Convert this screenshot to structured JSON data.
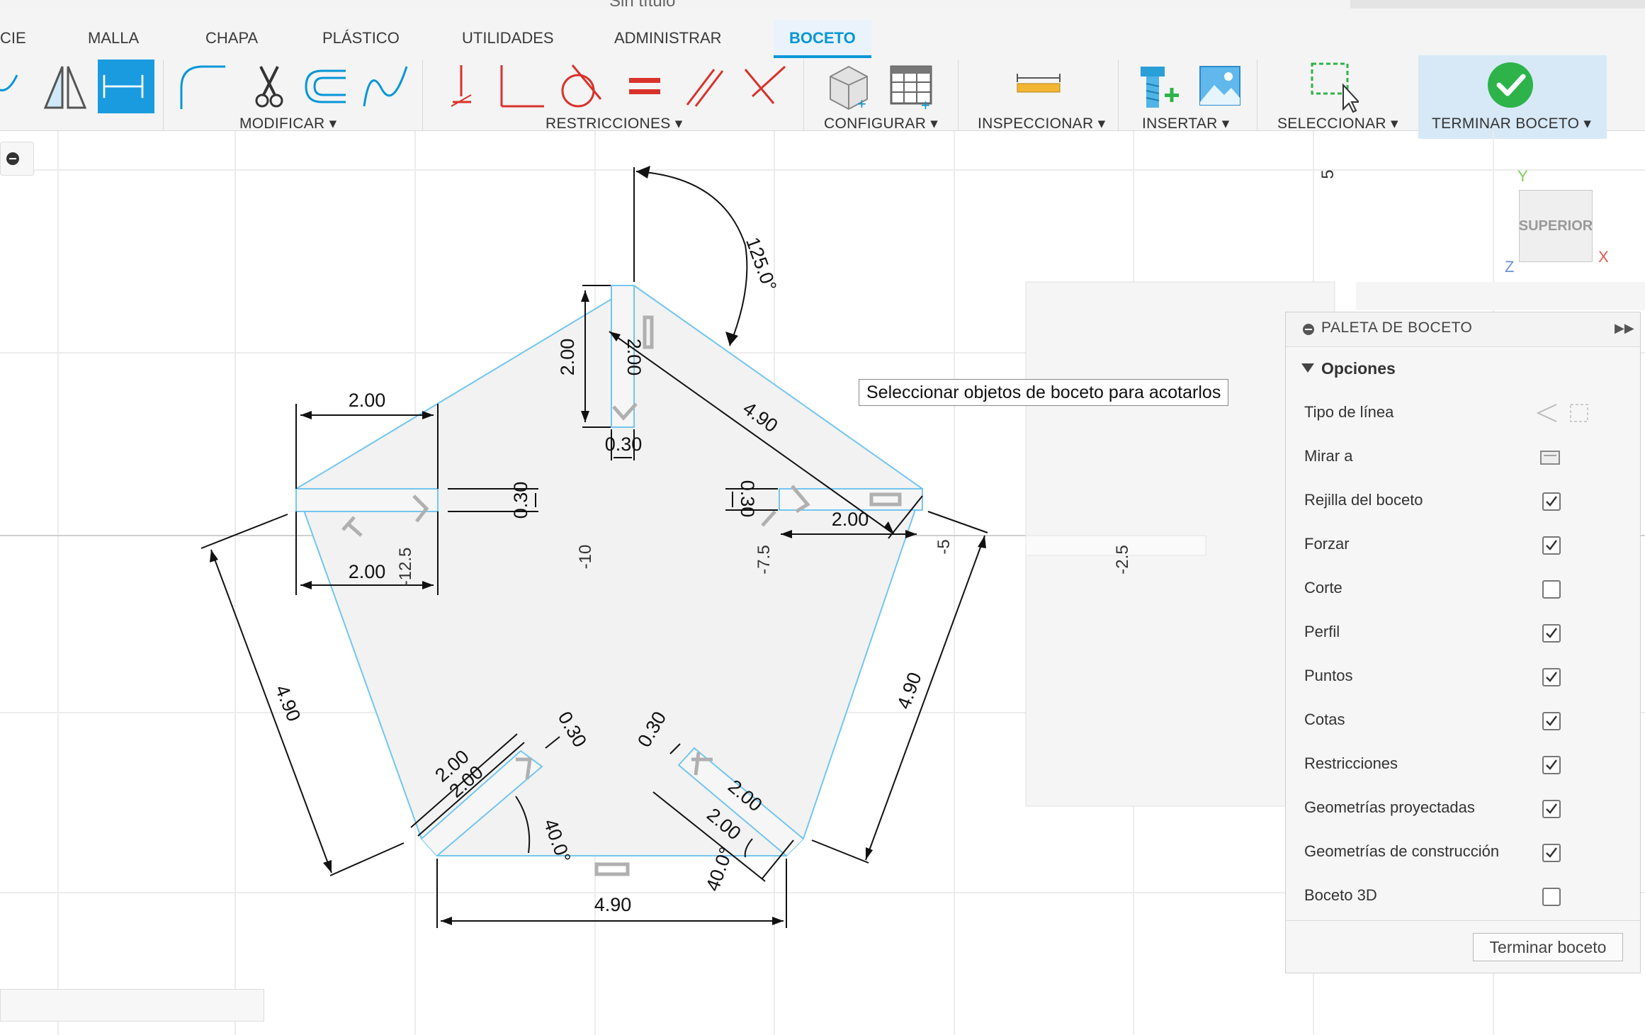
{
  "window": {
    "title": "Sin título"
  },
  "tabs": [
    {
      "label": "CIE"
    },
    {
      "label": "MALLA"
    },
    {
      "label": "CHAPA"
    },
    {
      "label": "PLÁSTICO"
    },
    {
      "label": "UTILIDADES"
    },
    {
      "label": "ADMINISTRAR"
    },
    {
      "label": "BOCETO"
    }
  ],
  "active_tab": "BOCETO",
  "groups": {
    "modificar": "MODIFICAR ▾",
    "restricciones": "RESTRICCIONES ▾",
    "configurar": "CONFIGURAR ▾",
    "inspeccionar": "INSPECCIONAR ▾",
    "insertar": "INSERTAR ▾",
    "seleccionar": "SELECCIONAR ▾",
    "terminar": "TERMINAR BOCETO ▾"
  },
  "tooltip": "Seleccionar objetos de boceto para acotarlos",
  "viewcube": {
    "face": "SUPERIOR",
    "x": "X",
    "y": "Y",
    "z": "Z"
  },
  "grid_labels": {
    "top_5": "5",
    "neg_12_5": "-12.5",
    "neg_10": "-10",
    "neg_7_5": "-7.5",
    "neg_5": "-5",
    "neg_2_5": "-2.5"
  },
  "dimensions": {
    "angle_top": "125.0°",
    "top_vertical": "2.00",
    "top_slot": "2.00",
    "top_slot_width": "0.30",
    "upper_right_edge": "4.90",
    "left_top_width": "2.00",
    "left_slot_height": "0.30",
    "left_bottom_width": "2.00",
    "right_slot_height": "0.30",
    "right_width": "2.00",
    "left_edge": "4.90",
    "right_edge": "4.90",
    "bottom_edge": "4.90",
    "bl_slot_a": "2.00",
    "bl_slot_b": "2.00",
    "bl_slot_width": "0.30",
    "bl_angle": "40.0°",
    "br_slot_width": "0.30",
    "br_slot_a": "2.00",
    "br_slot_b": "2.00",
    "br_angle": "40.0°"
  },
  "palette": {
    "title": "PALETA DE BOCETO",
    "section": "Opciones",
    "options": [
      {
        "label": "Tipo de línea",
        "kind": "icons"
      },
      {
        "label": "Mirar a",
        "kind": "icon"
      },
      {
        "label": "Rejilla del boceto",
        "checked": true
      },
      {
        "label": "Forzar",
        "checked": true
      },
      {
        "label": "Corte",
        "checked": false
      },
      {
        "label": "Perfil",
        "checked": true
      },
      {
        "label": "Puntos",
        "checked": true
      },
      {
        "label": "Cotas",
        "checked": true
      },
      {
        "label": "Restricciones",
        "checked": true
      },
      {
        "label": "Geometrías proyectadas",
        "checked": true
      },
      {
        "label": "Geometrías de construcción",
        "checked": true
      },
      {
        "label": "Boceto 3D",
        "checked": false
      }
    ],
    "finish_button": "Terminar boceto"
  },
  "colors": {
    "accent": "#0696d7",
    "sketch": "#6fc3ee",
    "profile_fill": "#f2f2f2",
    "finish_green": "#2db34a"
  }
}
